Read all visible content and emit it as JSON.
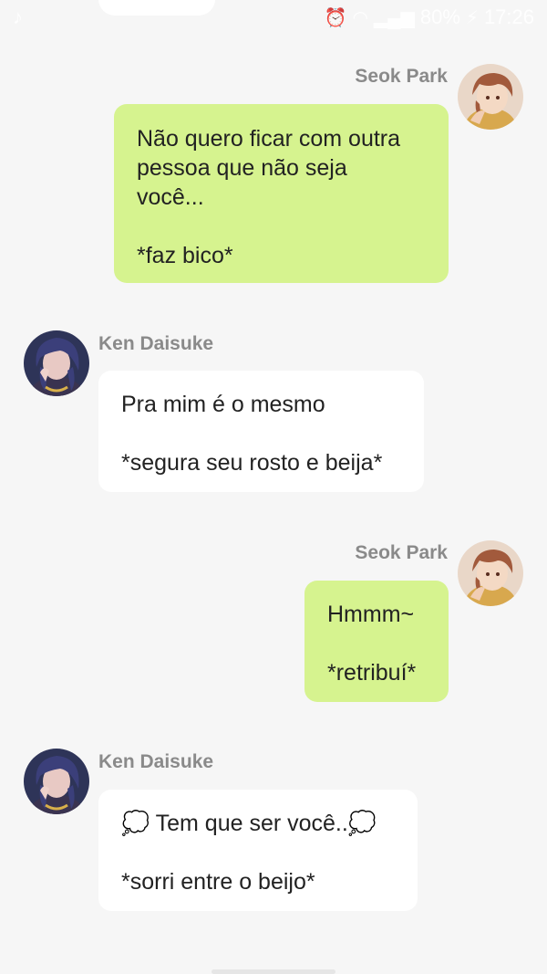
{
  "status_bar": {
    "left_icon": "tiktok-icon",
    "battery": "80%",
    "time": "17:26"
  },
  "messages": [
    {
      "side": "right",
      "sender": "Seok Park",
      "avatar": "seok-avatar",
      "lines": "Não quero ficar com outra\npessoa que não seja\nvocê...\n\n*faz bico*"
    },
    {
      "side": "left",
      "sender": "Ken Daisuke",
      "avatar": "ken-avatar",
      "lines": "Pra mim é o mesmo\n\n*segura seu rosto e beija*"
    },
    {
      "side": "right",
      "sender": "Seok Park",
      "avatar": "seok-avatar",
      "lines": "Hmmm~\n\n*retribuí*"
    },
    {
      "side": "left",
      "sender": "Ken Daisuke",
      "avatar": "ken-avatar",
      "lines": "💭 Tem que ser você..💭\n\n*sorri entre o beijo*"
    }
  ],
  "colors": {
    "sent_bubble": "#d6f38f",
    "received_bubble": "#ffffff",
    "background": "#f6f6f6",
    "name": "#8a8a8a"
  }
}
